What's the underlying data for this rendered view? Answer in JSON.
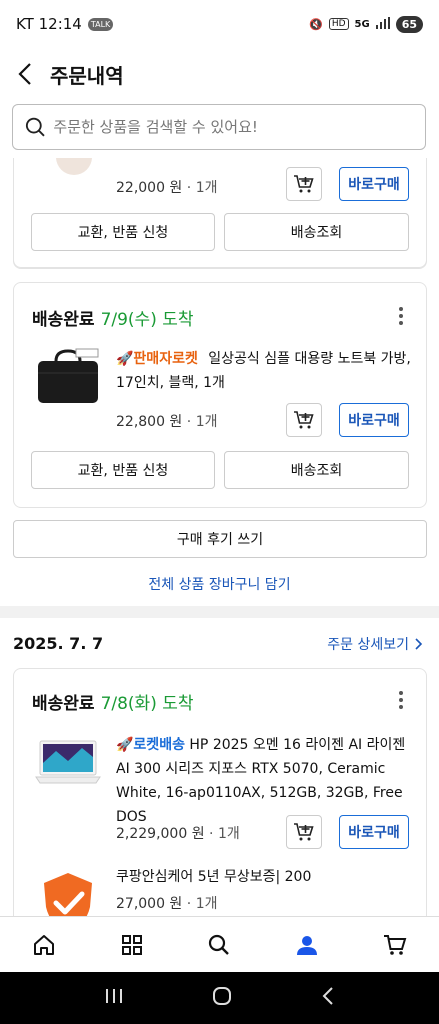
{
  "status_bar": {
    "carrier_time": "KT 12:14",
    "talk_badge": "TALK",
    "network": "5G",
    "battery": "65"
  },
  "header": {
    "title": "주문내역"
  },
  "search": {
    "placeholder": "주문한 상품을 검색할 수 있어요!"
  },
  "orders": [
    {
      "items": [
        {
          "price": "22,000 원",
          "qty": "1개",
          "cart_icon": "add-to-cart-icon",
          "buy_label": "바로구매"
        }
      ],
      "actions": {
        "exchange": "교환, 반품 신청",
        "tracking": "배송조회"
      }
    },
    {
      "status": "배송완료",
      "arrival": "7/9(수) 도착",
      "items": [
        {
          "badge": "🚀판매자로켓",
          "name": "일상공식 심플 대용량 노트북 가방, 17인치, 블랙, 1개",
          "price": "22,800 원",
          "qty": "1개",
          "buy_label": "바로구매"
        }
      ],
      "actions": {
        "exchange": "교환, 반품 신청",
        "tracking": "배송조회"
      }
    }
  ],
  "group_actions": {
    "review": "구매 후기 쓰기",
    "add_all_cart": "전체 상품 장바구니 담기"
  },
  "order_group_2": {
    "date": "2025. 7. 7",
    "detail_link": "주문 상세보기",
    "status": "배송완료",
    "arrival": "7/8(화) 도착",
    "items": [
      {
        "badge": "🚀로켓배송",
        "name": "HP 2025 오멘 16 라이젠 AI 라이젠 AI 300 시리즈 지포스 RTX 5070, Ceramic White, 16-ap0110AX, 512GB, 32GB, Free DOS",
        "price": "2,229,000 원",
        "qty": "1개",
        "buy_label": "바로구매"
      },
      {
        "name": "쿠팡안심케어 5년 무상보증| 200",
        "price": "27,000 원",
        "qty": "1개"
      }
    ]
  },
  "bottom_nav": [
    "home-icon",
    "category-icon",
    "search-icon",
    "my-page-icon",
    "cart-icon"
  ],
  "colors": {
    "accent_blue": "#1a56b8",
    "delivered_green": "#1a9a35",
    "seller_orange": "#e8620f"
  }
}
